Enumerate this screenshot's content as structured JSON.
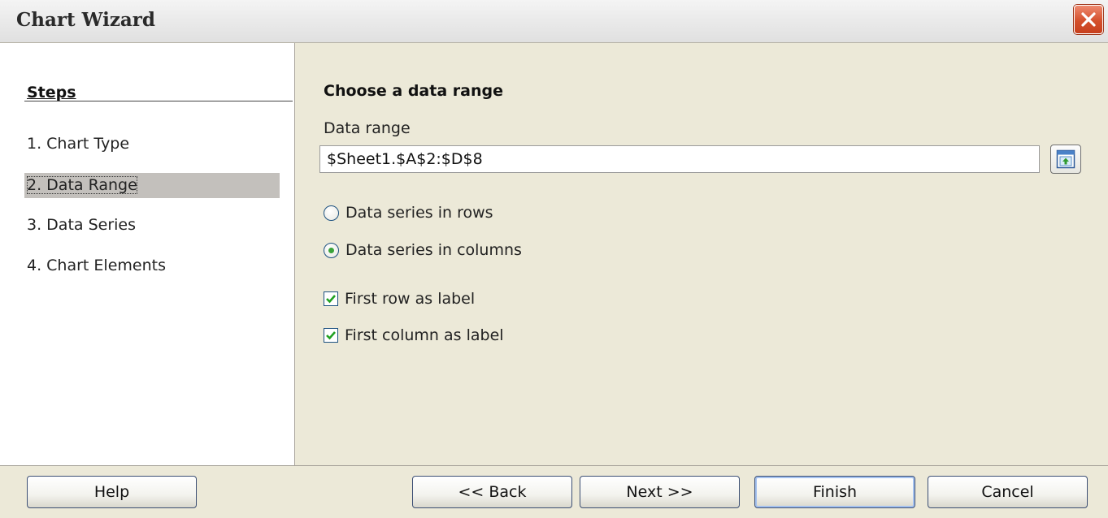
{
  "window": {
    "title": "Chart Wizard"
  },
  "steps": {
    "heading": "Steps",
    "items": [
      {
        "label": "1. Chart Type"
      },
      {
        "label": "2. Data Range",
        "active": true
      },
      {
        "label": "3. Data Series"
      },
      {
        "label": "4. Chart Elements"
      }
    ]
  },
  "content": {
    "heading": "Choose a data range",
    "data_range_label": "Data range",
    "data_range_value": "$Sheet1.$A$2:$D$8",
    "radio_rows": {
      "label": "Data series in rows",
      "checked": false
    },
    "radio_columns": {
      "label": "Data series in columns",
      "checked": true
    },
    "check_first_row": {
      "label": "First row as label",
      "checked": true
    },
    "check_first_column": {
      "label": "First column as label",
      "checked": true
    }
  },
  "buttons": {
    "help": "Help",
    "back": "<< Back",
    "next": "Next >>",
    "finish": "Finish",
    "cancel": "Cancel"
  },
  "colors": {
    "dialog_bg": "#ece9d8",
    "close_button": "#d4502c",
    "radio_dot": "#3aa339",
    "checkmark": "#21a121"
  }
}
